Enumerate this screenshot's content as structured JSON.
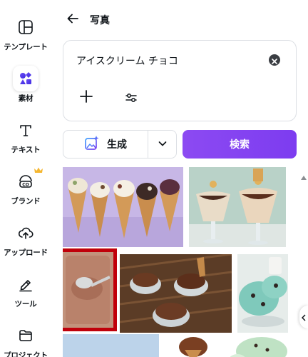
{
  "sidebar": {
    "items": [
      {
        "label": "テンプレート",
        "icon": "template-icon"
      },
      {
        "label": "素材",
        "icon": "elements-icon",
        "active": true
      },
      {
        "label": "テキスト",
        "icon": "text-icon"
      },
      {
        "label": "ブランド",
        "icon": "brand-icon",
        "badge": "crown-icon"
      },
      {
        "label": "アップロード",
        "icon": "upload-icon"
      },
      {
        "label": "ツール",
        "icon": "draw-tool-icon"
      },
      {
        "label": "プロジェクト",
        "icon": "folder-icon"
      }
    ]
  },
  "header": {
    "title": "写真",
    "back_icon": "arrow-left-icon"
  },
  "search": {
    "value": "アイスクリーム チョコ",
    "clear_icon": "clear-icon",
    "add_icon": "plus-icon",
    "filter_icon": "sliders-icon"
  },
  "actions": {
    "generate_label": "生成",
    "search_label": "検索",
    "generate_icon": "magic-image-icon",
    "dropdown_icon": "chevron-down-icon"
  },
  "colors": {
    "accent": "#7d3cf0",
    "selection": "#c0000a",
    "brand_crown": "#f5b731"
  },
  "results": [
    {
      "name": "photo-ice-cream-cones"
    },
    {
      "name": "photo-chocolate-sundaes"
    },
    {
      "name": "photo-chocolate-ice-cream-scoop"
    },
    {
      "name": "photo-chocolate-ice-cream-bowls"
    },
    {
      "name": "photo-mint-chocolate-ice-cream"
    },
    {
      "name": "photo-blue-background"
    },
    {
      "name": "photo-ice-cream-cone-chocolate"
    },
    {
      "name": "photo-mint-chip-ice-cream"
    }
  ]
}
